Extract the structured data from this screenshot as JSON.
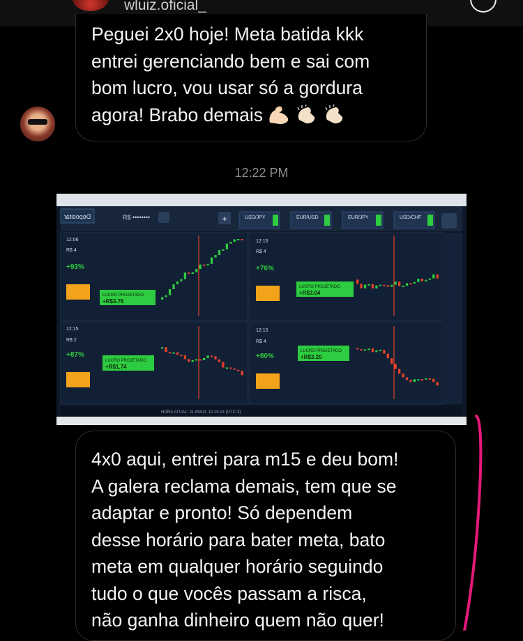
{
  "header": {
    "username": "wluiz.oficial_"
  },
  "messages": [
    {
      "lines": [
        "Peguei 2x0 hoje! Meta batida kkk",
        "entrei gerenciando bem e sai com",
        "bom lucro, vou usar só a gordura",
        "agora! Brabo demais"
      ],
      "emojis": [
        "flexed-biceps",
        "clapping-hands",
        "clapping-hands"
      ]
    },
    {
      "lines": [
        "4x0 aqui, entrei para m15 e deu bom!",
        "A galera reclama demais, tem que se",
        "adaptar e pronto! Só dependem",
        "desse horário para bater meta, bato",
        "meta em qualquer horário seguindo",
        "tudo o que vocês passam a risca,",
        "não ganha dinheiro quem não quer!"
      ]
    }
  ],
  "timestamp": "12:22 PM",
  "screenshot": {
    "deposit_label": "Depositar",
    "balance_mask": "R$ ••••••••",
    "tabs": [
      "USD/JPY",
      "EUR/USD",
      "EUR/JPY",
      "USD/CHF"
    ],
    "panels": [
      {
        "pair": "USD/JPY",
        "amount": "R$ 4",
        "timer": "12:06",
        "profit": "+93%",
        "result": "+R$3.76",
        "label": "LUCRO PROJETADO",
        "trend": "up"
      },
      {
        "pair": "EUR/JPY",
        "amount": "R$ 4",
        "timer": "12:15",
        "profit": "+76%",
        "result": "+R$3.04",
        "label": "LUCRO PROJETADO",
        "trend": "flat"
      },
      {
        "pair": "EUR/USD",
        "amount": "R$ 2",
        "timer": "12:15",
        "profit": "+87%",
        "result": "+R$1.74",
        "label": "LUCRO PROJETADO",
        "trend": "down"
      },
      {
        "pair": "USD/CHF",
        "amount": "R$ 4",
        "timer": "12:15",
        "profit": "+80%",
        "result": "+R$3.20",
        "label": "LUCRO PROJETADO",
        "trend": "down"
      }
    ],
    "status_bar": "HORA ATUAL: 21 MAIO, 12:18:14 (UTC-3)",
    "colors": {
      "bull": "#2ecc40",
      "bear": "#e8412b",
      "accent": "#f2a21b"
    }
  }
}
